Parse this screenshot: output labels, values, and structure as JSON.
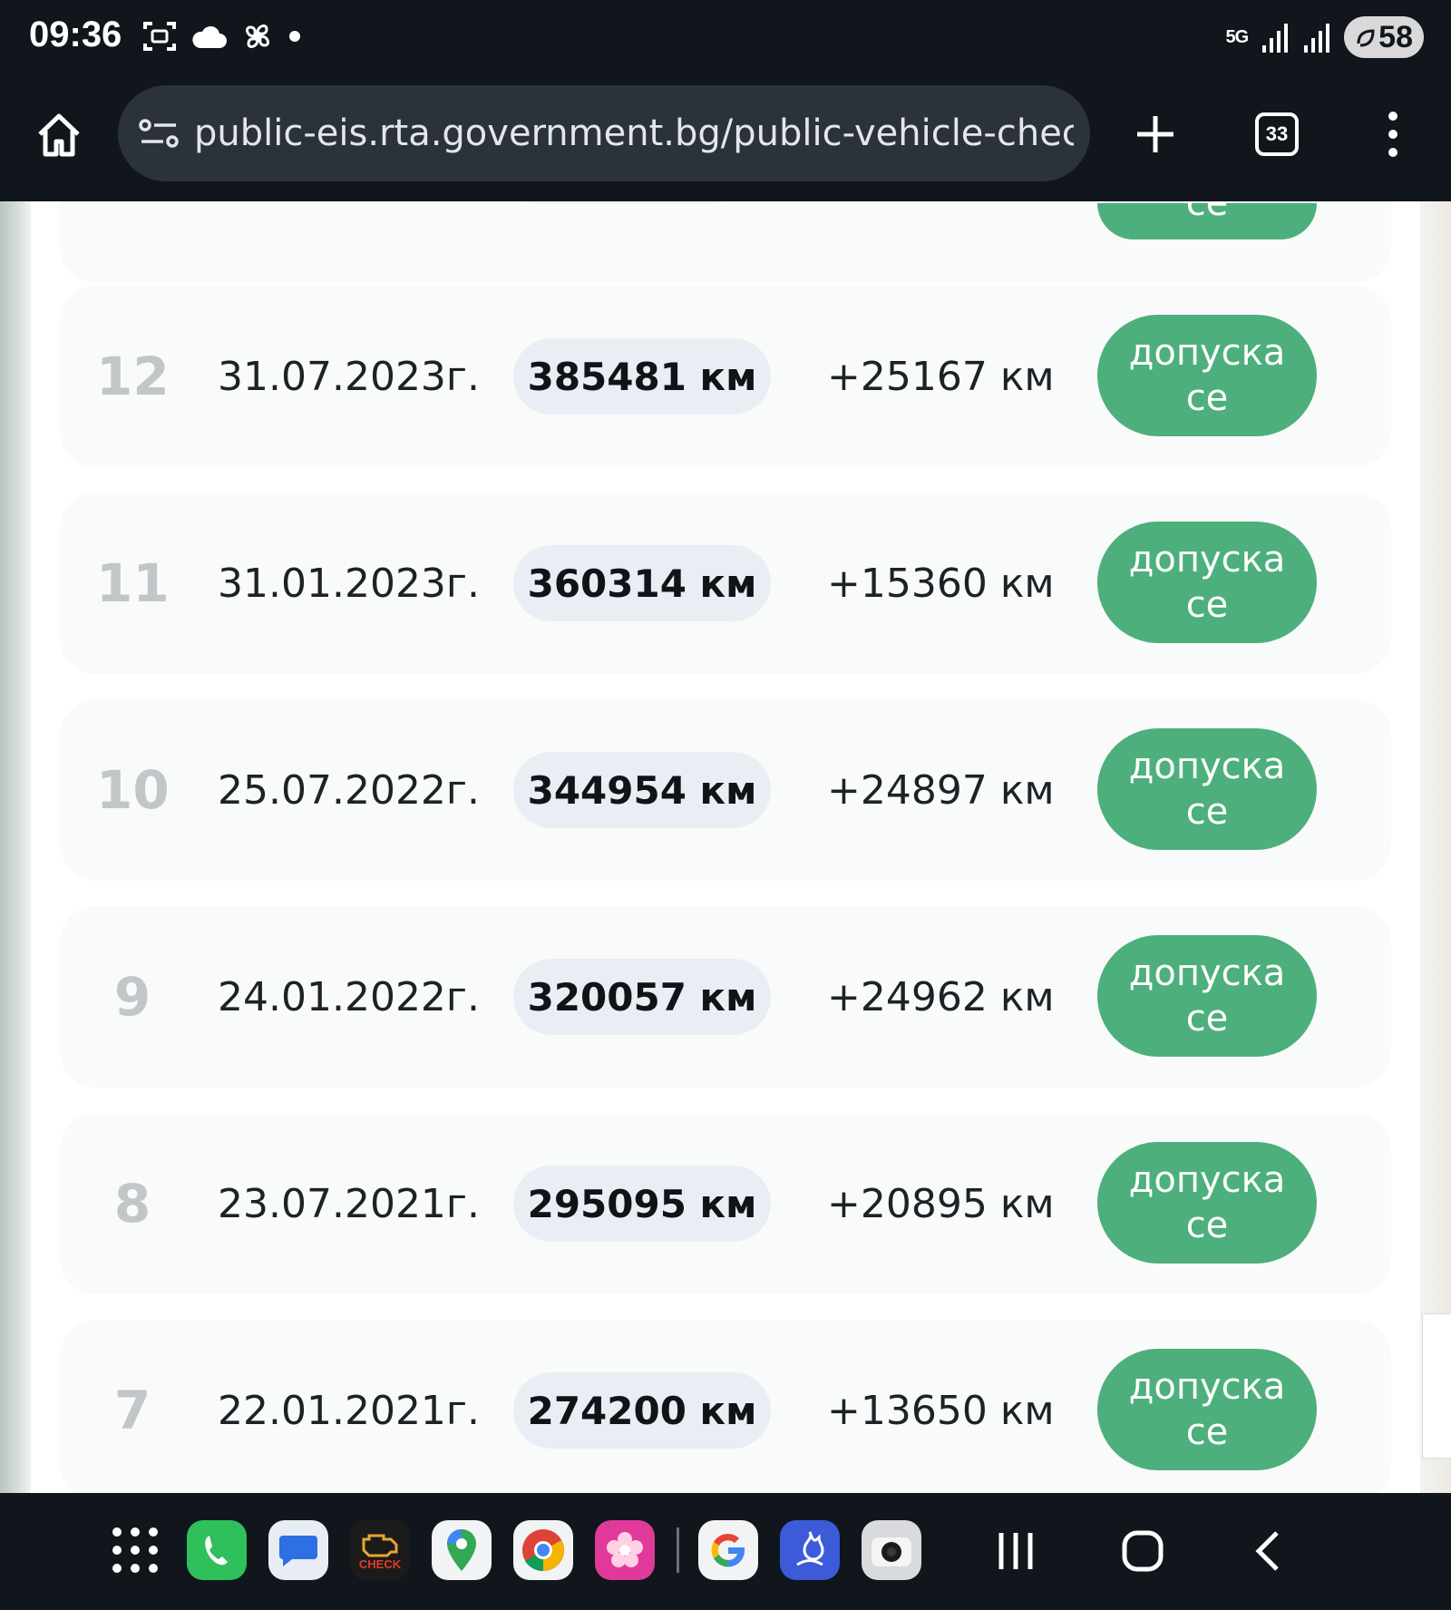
{
  "status_bar": {
    "time": "09:36",
    "network": "5G",
    "battery": "58",
    "icons": [
      "screenshot-icon",
      "cloud-icon",
      "fan-icon",
      "dot-icon",
      "signal-icon",
      "signal-icon",
      "battery-icon"
    ]
  },
  "browser": {
    "url": "public-eis.rta.government.bg/public-vehicle-chec",
    "tab_count": "33",
    "icons": [
      "home-icon",
      "site-info-icon",
      "plus-icon",
      "tabs-icon",
      "more-vert-icon"
    ]
  },
  "inspections": {
    "partial_button_label": "се",
    "rows": [
      {
        "num": "12",
        "date": "31.07.2023г.",
        "km": "385481 км",
        "diff": "+25167 км",
        "status": "допуска се"
      },
      {
        "num": "11",
        "date": "31.01.2023г.",
        "km": "360314 км",
        "diff": "+15360 км",
        "status": "допуска се"
      },
      {
        "num": "10",
        "date": "25.07.2022г.",
        "km": "344954 км",
        "diff": "+24897 км",
        "status": "допуска се"
      },
      {
        "num": "9",
        "date": "24.01.2022г.",
        "km": "320057 км",
        "diff": "+24962 км",
        "status": "допуска се"
      },
      {
        "num": "8",
        "date": "23.07.2021г.",
        "km": "295095 км",
        "diff": "+20895 км",
        "status": "допуска се"
      },
      {
        "num": "7",
        "date": "22.01.2021г.",
        "km": "274200 км",
        "diff": "+13650 км",
        "status": "допуска се"
      }
    ]
  },
  "taskbar": {
    "apps": [
      {
        "name": "app-drawer-icon"
      },
      {
        "name": "phone-app-icon",
        "color": "#2fbf5b"
      },
      {
        "name": "messages-app-icon",
        "color": "#e8edf4"
      },
      {
        "name": "obd-check-app-icon",
        "color": "#1b1b1b",
        "label": "CHECK"
      },
      {
        "name": "maps-app-icon",
        "color": "#f1f3f4"
      },
      {
        "name": "chrome-app-icon",
        "color": "#f1f3f4"
      },
      {
        "name": "gallery-app-icon",
        "color": "#e0399a"
      },
      {
        "name": "google-app-icon",
        "color": "#f1f3f4"
      },
      {
        "name": "fireplace-app-icon",
        "color": "#3d5bd8"
      },
      {
        "name": "camera-app-icon",
        "color": "#d8dadd"
      }
    ],
    "nav": [
      "recents-icon",
      "home-nav-icon",
      "back-icon"
    ]
  },
  "colors": {
    "accent_green": "#4daf7c",
    "pill_bg": "#e9eef4",
    "row_bg": "#f9fafa",
    "system_bar": "#10161c"
  }
}
